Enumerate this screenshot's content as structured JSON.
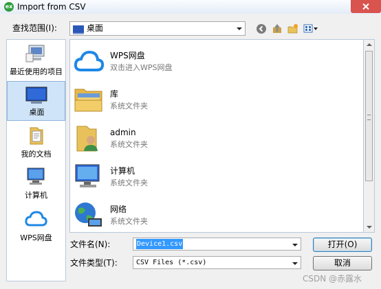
{
  "window": {
    "title": "Import from CSV",
    "app_icon_text": "ex"
  },
  "lookin": {
    "label": "查找范围(I):",
    "value": "桌面"
  },
  "places": [
    {
      "label": "最近使用的项目"
    },
    {
      "label": "桌面"
    },
    {
      "label": "我的文档"
    },
    {
      "label": "计算机"
    },
    {
      "label": "WPS网盘"
    }
  ],
  "files": [
    {
      "name": "WPS网盘",
      "desc": "双击进入WPS网盘"
    },
    {
      "name": "库",
      "desc": "系统文件夹"
    },
    {
      "name": "admin",
      "desc": "系统文件夹"
    },
    {
      "name": "计算机",
      "desc": "系统文件夹"
    },
    {
      "name": "网络",
      "desc": "系统文件夹"
    }
  ],
  "filename": {
    "label": "文件名(N):",
    "value": "Device1.csv"
  },
  "filetype": {
    "label": "文件类型(T):",
    "value": "CSV Files (*.csv)"
  },
  "buttons": {
    "open": "打开(O)",
    "cancel": "取消"
  },
  "watermark": "CSDN @赤露水",
  "colors": {
    "selection": "#cfe4f8",
    "highlight": "#3399ff",
    "close": "#d9534f",
    "accent": "#1e88e5"
  }
}
